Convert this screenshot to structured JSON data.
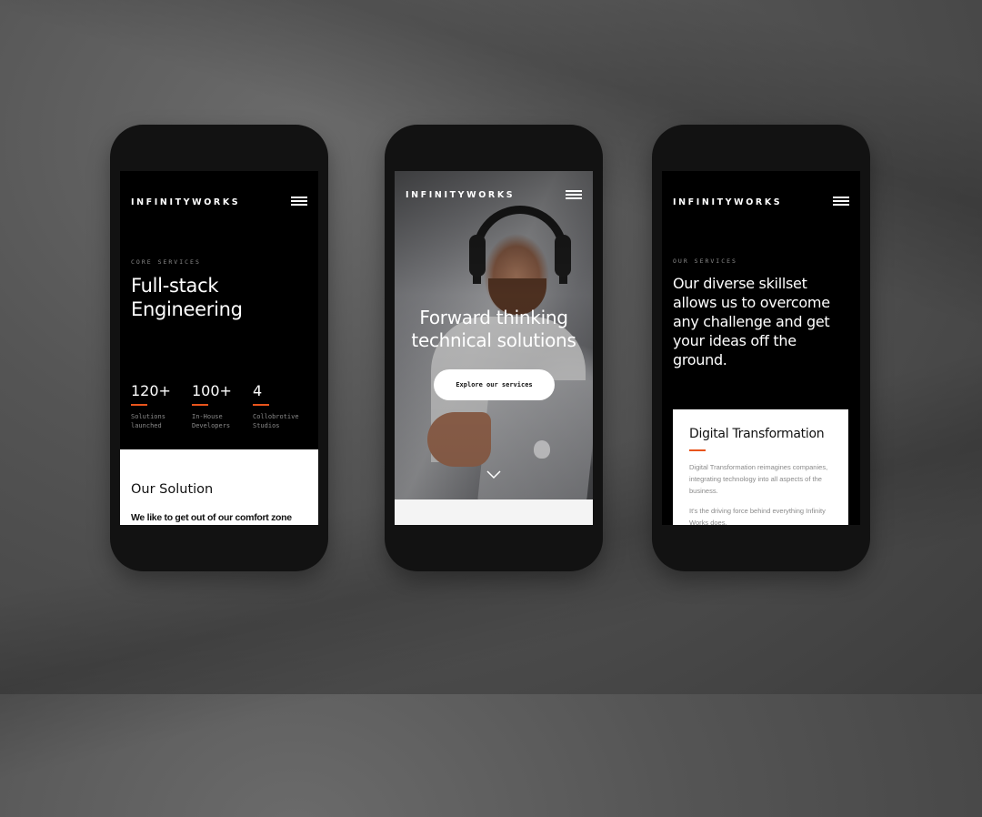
{
  "brand": {
    "logo": "INFINITYWORKS",
    "accent_color": "#e8541c"
  },
  "phones": [
    {
      "eyebrow": "CORE SERVICES",
      "title_line1": "Full-stack",
      "title_line2": "Engineering",
      "stats": [
        {
          "value": "120+",
          "label_line1": "Solutions",
          "label_line2": "launched"
        },
        {
          "value": "100+",
          "label_line1": "In-House",
          "label_line2": "Developers"
        },
        {
          "value": "4",
          "label_line1": "Collobrotive",
          "label_line2": "Studios"
        }
      ],
      "section_title": "Our Solution",
      "section_text": "We like to get out of our comfort zone"
    },
    {
      "hero_line1": "Forward thinking",
      "hero_line2": "technical solutions",
      "cta_label": "Explore our services",
      "scroll_icon": "chevron-down-icon"
    },
    {
      "eyebrow": "OUR SERVICES",
      "headline": "Our diverse skillset allows us to overcome any challenge and get your ideas off the ground.",
      "card": {
        "title": "Digital Transformation",
        "paragraph1": "Digital Transformation reimagines companies, integrating technology into all aspects of the business.",
        "paragraph2": "It's the driving force behind everything Infinity Works does."
      }
    }
  ],
  "icons": {
    "menu": "hamburger-menu-icon"
  }
}
